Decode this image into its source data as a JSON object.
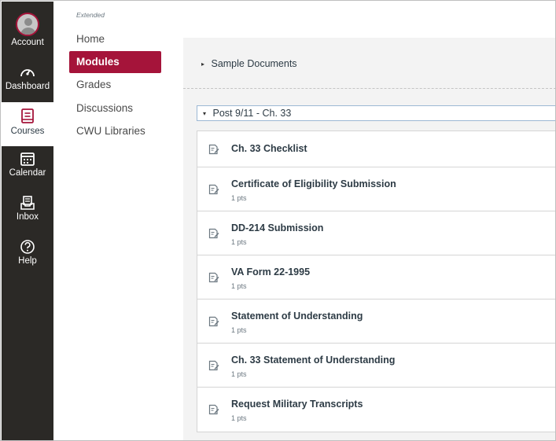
{
  "global_nav": {
    "items": [
      {
        "label": "Account",
        "icon": "account-avatar-icon"
      },
      {
        "label": "Dashboard",
        "icon": "gauge-icon"
      },
      {
        "label": "Courses",
        "icon": "book-icon"
      },
      {
        "label": "Calendar",
        "icon": "calendar-icon"
      },
      {
        "label": "Inbox",
        "icon": "inbox-icon"
      },
      {
        "label": "Help",
        "icon": "question-circle-icon"
      }
    ]
  },
  "course_nav": {
    "term": "Extended",
    "items": [
      {
        "label": "Home"
      },
      {
        "label": "Modules"
      },
      {
        "label": "Grades"
      },
      {
        "label": "Discussions"
      },
      {
        "label": "CWU Libraries"
      }
    ]
  },
  "modules": [
    {
      "title": "Sample Documents",
      "caret": "▸",
      "state": "collapsed"
    },
    {
      "title": "Post 9/11 - Ch. 33",
      "caret": "▾",
      "state": "expanded",
      "items": [
        {
          "title": "Ch. 33 Checklist",
          "points": ""
        },
        {
          "title": "Certificate of Eligibility Submission",
          "points": "1 pts"
        },
        {
          "title": "DD-214 Submission",
          "points": "1 pts"
        },
        {
          "title": "VA Form 22-1995",
          "points": "1 pts"
        },
        {
          "title": "Statement of Understanding",
          "points": "1 pts"
        },
        {
          "title": "Ch. 33 Statement of Understanding",
          "points": "1 pts"
        },
        {
          "title": "Request Military Transcripts",
          "points": "1 pts"
        }
      ]
    }
  ],
  "colors": {
    "nav_bg": "#2b2926",
    "accent": "#a5143a",
    "content_bg": "#f3f3f3"
  }
}
